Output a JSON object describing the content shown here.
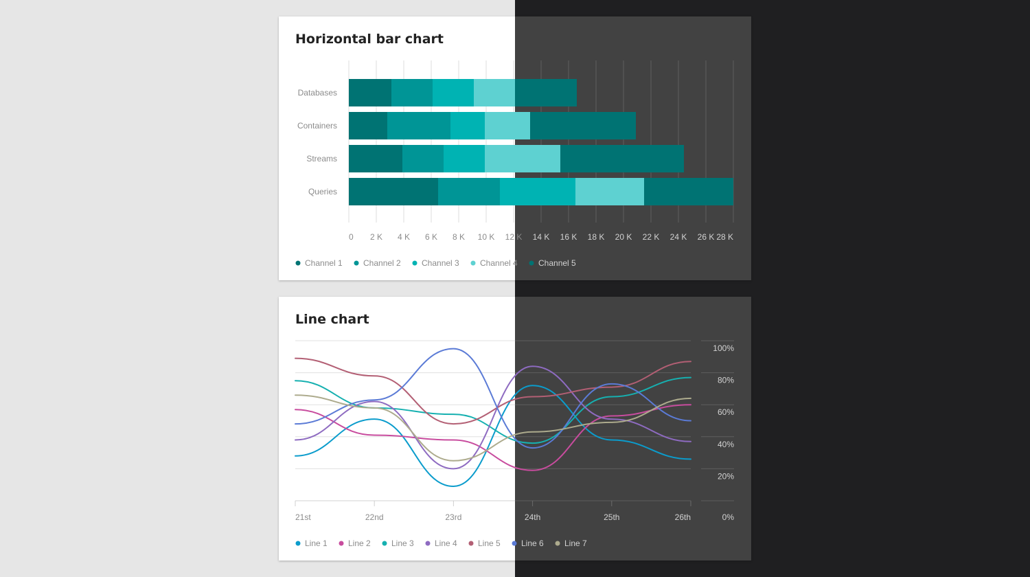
{
  "theme": {
    "light_bg": "#e6e6e6",
    "dark_bg": "#1f1f21",
    "card_light": "#ffffff",
    "card_dark": "#424242"
  },
  "chart_data": [
    {
      "type": "bar",
      "orientation": "horizontal",
      "stacked": true,
      "title": "Horizontal bar chart",
      "categories": [
        "Databases",
        "Containers",
        "Streams",
        "Queries"
      ],
      "xlim": [
        0,
        28000
      ],
      "x_ticks": [
        "0",
        "2 K",
        "4 K",
        "6 K",
        "8 K",
        "10 K",
        "12 K",
        "14 K",
        "16 K",
        "18 K",
        "20 K",
        "22 K",
        "24 K",
        "26 K",
        "28 K"
      ],
      "grid": true,
      "legend_position": "bottom-left",
      "series": [
        {
          "name": "Channel 1",
          "color": "#007373",
          "values": [
            3100,
            2800,
            3900,
            6500
          ]
        },
        {
          "name": "Channel 2",
          "color": "#009596",
          "values": [
            3000,
            4600,
            3000,
            4500
          ]
        },
        {
          "name": "Channel 3",
          "color": "#00b3b3",
          "values": [
            3000,
            2500,
            3000,
            5500
          ]
        },
        {
          "name": "Channel 4",
          "color": "#5ed1d1",
          "values": [
            3000,
            3300,
            5500,
            5000
          ]
        },
        {
          "name": "Channel 5",
          "color": "#007373",
          "values": [
            4500,
            7700,
            9000,
            6500
          ]
        }
      ]
    },
    {
      "type": "line",
      "title": "Line chart",
      "x": [
        "21st",
        "22nd",
        "23rd",
        "24th",
        "25th",
        "26th"
      ],
      "ylim": [
        0,
        100
      ],
      "y_ticks": [
        "0%",
        "20%",
        "40%",
        "60%",
        "80%",
        "100%"
      ],
      "grid": true,
      "legend_position": "bottom-left",
      "series": [
        {
          "name": "Line 1",
          "color": "#0b9ccc",
          "values": [
            28,
            51,
            9,
            72,
            38,
            26
          ]
        },
        {
          "name": "Line 2",
          "color": "#c84c9e",
          "values": [
            57,
            41,
            38,
            19,
            53,
            60
          ]
        },
        {
          "name": "Line 3",
          "color": "#16b0b0",
          "values": [
            75,
            58,
            54,
            36,
            65,
            77
          ]
        },
        {
          "name": "Line 4",
          "color": "#8e6bc1",
          "values": [
            38,
            62,
            20,
            84,
            51,
            37
          ]
        },
        {
          "name": "Line 5",
          "color": "#b35f74",
          "values": [
            89,
            78,
            48,
            65,
            71,
            87
          ]
        },
        {
          "name": "Line 6",
          "color": "#5b7bd6",
          "values": [
            48,
            63,
            95,
            33,
            73,
            50
          ]
        },
        {
          "name": "Line 7",
          "color": "#adab8d",
          "values": [
            66,
            58,
            25,
            43,
            49,
            64
          ]
        }
      ]
    }
  ]
}
